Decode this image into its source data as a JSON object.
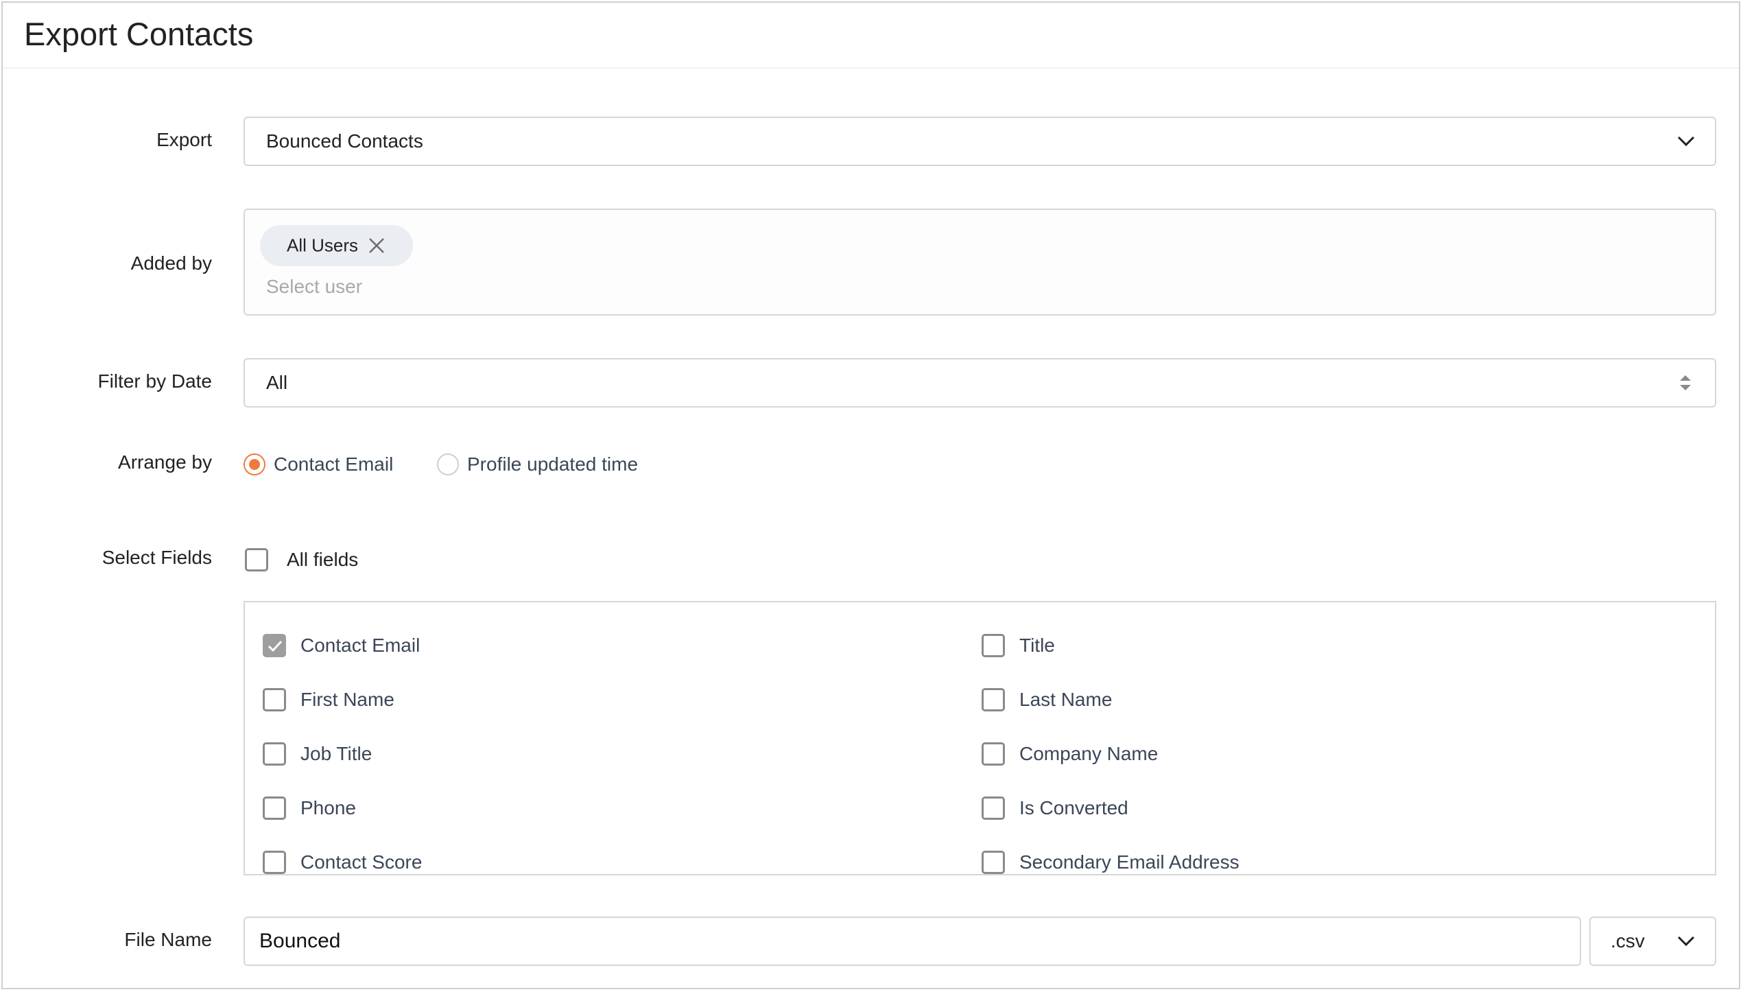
{
  "dialog": {
    "title": "Export Contacts"
  },
  "export": {
    "label": "Export",
    "selected": "Bounced Contacts",
    "icon": "chevron-down-icon"
  },
  "added_by": {
    "label": "Added by",
    "chips": [
      {
        "label": "All Users",
        "remove_icon": "close-icon"
      }
    ],
    "placeholder": "Select user"
  },
  "filter_by_date": {
    "label": "Filter by Date",
    "selected": "All",
    "icon": "sort-updown-icon"
  },
  "arrange_by": {
    "label": "Arrange by",
    "options": [
      {
        "label": "Contact Email",
        "selected": true
      },
      {
        "label": "Profile updated time",
        "selected": false
      }
    ]
  },
  "select_fields": {
    "label": "Select Fields",
    "all_fields_label": "All fields",
    "all_fields_checked": false,
    "fields": [
      {
        "label": "Contact Email",
        "checked": true,
        "disabled": true
      },
      {
        "label": "Title",
        "checked": false
      },
      {
        "label": "First Name",
        "checked": false
      },
      {
        "label": "Last Name",
        "checked": false
      },
      {
        "label": "Job Title",
        "checked": false
      },
      {
        "label": "Company Name",
        "checked": false
      },
      {
        "label": "Phone",
        "checked": false
      },
      {
        "label": "Is Converted",
        "checked": false
      },
      {
        "label": "Contact Score",
        "checked": false
      },
      {
        "label": "Secondary Email Address",
        "checked": false
      }
    ]
  },
  "file_name": {
    "label": "File Name",
    "value": "Bounced",
    "extension": ".csv",
    "icon": "chevron-down-icon"
  },
  "colors": {
    "accent": "#f07a3c",
    "label_text": "#3b4657",
    "border": "#d6d6d6",
    "chip_bg": "#eaedf2",
    "checked_disabled": "#9e9e9e"
  }
}
